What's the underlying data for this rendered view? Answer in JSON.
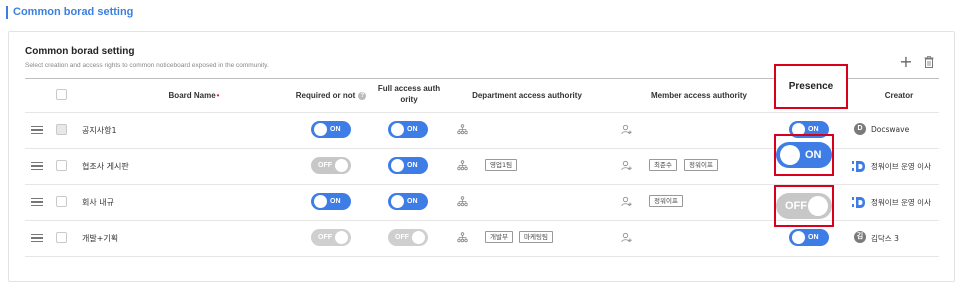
{
  "page": {
    "title": "Common borad setting"
  },
  "panel": {
    "title": "Common borad setting",
    "description": "Select creation and access rights to common noticeboard exposed in the community."
  },
  "toolbar": {
    "add_icon": "plus-icon",
    "delete_icon": "trash-icon"
  },
  "columns": {
    "board_name": "Board Name",
    "required": "Required or not",
    "full_access_line1": "Full access auth",
    "full_access_line2": "ority",
    "department": "Department access authority",
    "member": "Member access authority",
    "presence": "Presence",
    "creator": "Creator"
  },
  "toggle_labels": {
    "on": "ON",
    "off": "OFF"
  },
  "rows": [
    {
      "name": "공지사항1",
      "required": "ON",
      "full_access": "ON",
      "departments": [],
      "members": [],
      "presence": "ON",
      "creator": {
        "avatar": "D",
        "name": "Docswave",
        "type": "avatar"
      }
    },
    {
      "name": "협조사 게시판",
      "required": "OFF",
      "full_access": "ON",
      "departments": [
        "영업1팀"
      ],
      "members": [
        "최준수",
        "정워이프"
      ],
      "presence": "ON",
      "creator": {
        "name": "정워이브 운영 이사",
        "type": "logo"
      }
    },
    {
      "name": "회사 내규",
      "required": "ON",
      "full_access": "ON",
      "departments": [],
      "members": [
        "정워이프"
      ],
      "presence": "OFF",
      "creator": {
        "name": "정워이브 운영 이사",
        "type": "logo"
      }
    },
    {
      "name": "개발+기획",
      "required": "OFF",
      "full_access": "OFF",
      "departments": [
        "개발부",
        "마케팅팀"
      ],
      "members": [],
      "presence": "ON",
      "creator": {
        "avatar": "김",
        "name": "김닥스 3",
        "type": "avatar"
      }
    }
  ],
  "colors": {
    "accent": "#3e7de6",
    "toggle_off": "#c7c7c7",
    "highlight": "#d9001b",
    "title": "#3d7fe0"
  }
}
